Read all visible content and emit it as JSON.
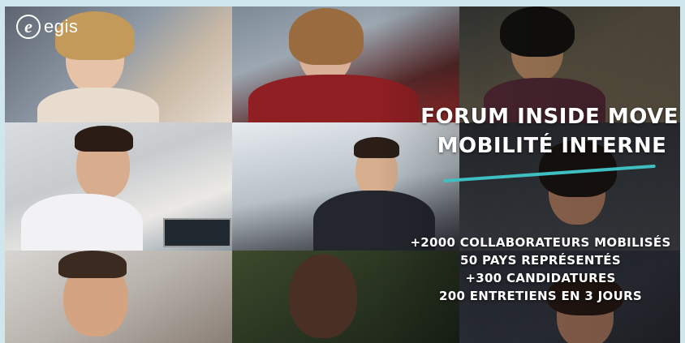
{
  "brand": {
    "logo_mark": "e",
    "logo_text": "egis"
  },
  "headline": {
    "line1": "FORUM INSIDE MOVE",
    "line2": "MOBILITÉ INTERNE"
  },
  "stats": [
    "+2000 COLLABORATEURS MOBILISÉS",
    "50 PAYS REPRÉSENTÉS",
    "+300 CANDIDATURES",
    "200 ENTRETIENS EN 3 JOURS"
  ],
  "colors": {
    "accent_line": "#3fbfc2",
    "page_background": "#cfe6ec",
    "text": "#ffffff"
  }
}
